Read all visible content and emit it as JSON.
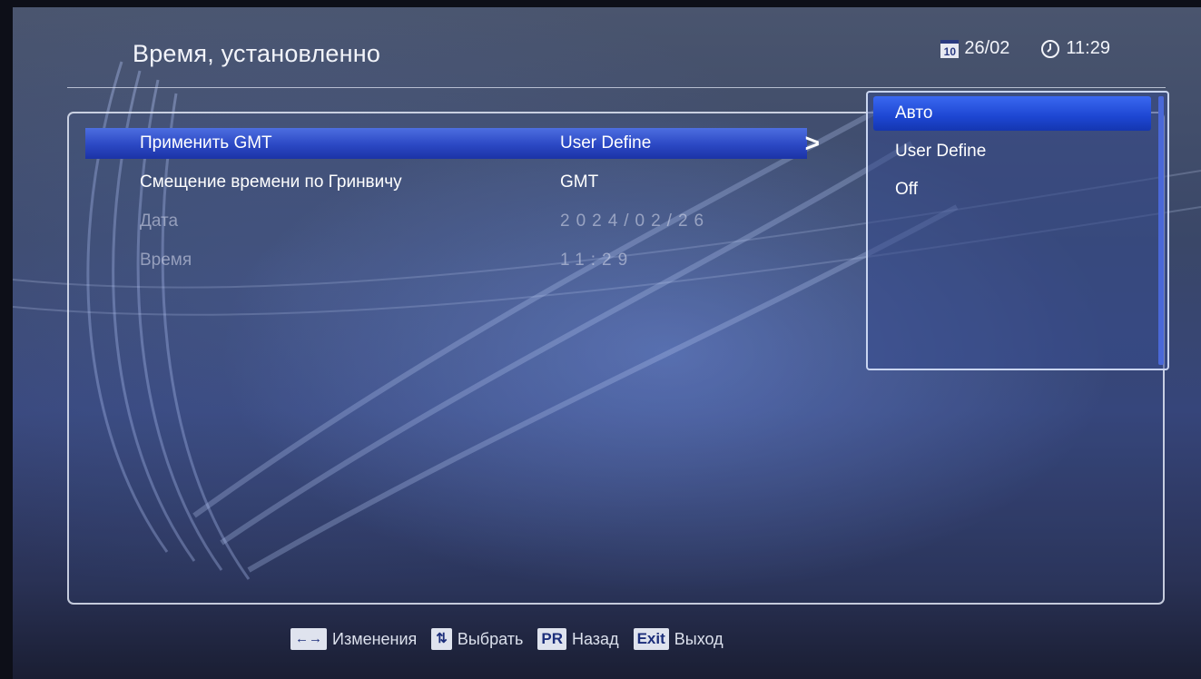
{
  "header": {
    "title": "Время, установленно",
    "date": "26/02",
    "calendar_icon_text": "10",
    "time": "11:29"
  },
  "settings": [
    {
      "label": "Применить GMT",
      "value": "User Define",
      "state": "selected"
    },
    {
      "label": "Смещение времени по Гринвичу",
      "value": "GMT",
      "state": "normal"
    },
    {
      "label": "Дата",
      "value": "2024/02/26",
      "state": "disabled"
    },
    {
      "label": "Время",
      "value": "11:29",
      "state": "disabled"
    }
  ],
  "dropdown": {
    "options": [
      "Авто",
      "User Define",
      "Off"
    ],
    "selected": "Авто"
  },
  "footer": {
    "keys": [
      {
        "key": "←→",
        "action": "Изменения"
      },
      {
        "key": "⇅",
        "action": "Выбрать"
      },
      {
        "key": "PR",
        "action": "Назад"
      },
      {
        "key": "Exit",
        "action": "Выход"
      }
    ]
  },
  "colors": {
    "highlight": "#2b48c4",
    "dropdown_highlight": "#1d46d2",
    "text": "#ffffff",
    "key_bg": "#dfe3ee",
    "key_text": "#1c2e7a"
  }
}
